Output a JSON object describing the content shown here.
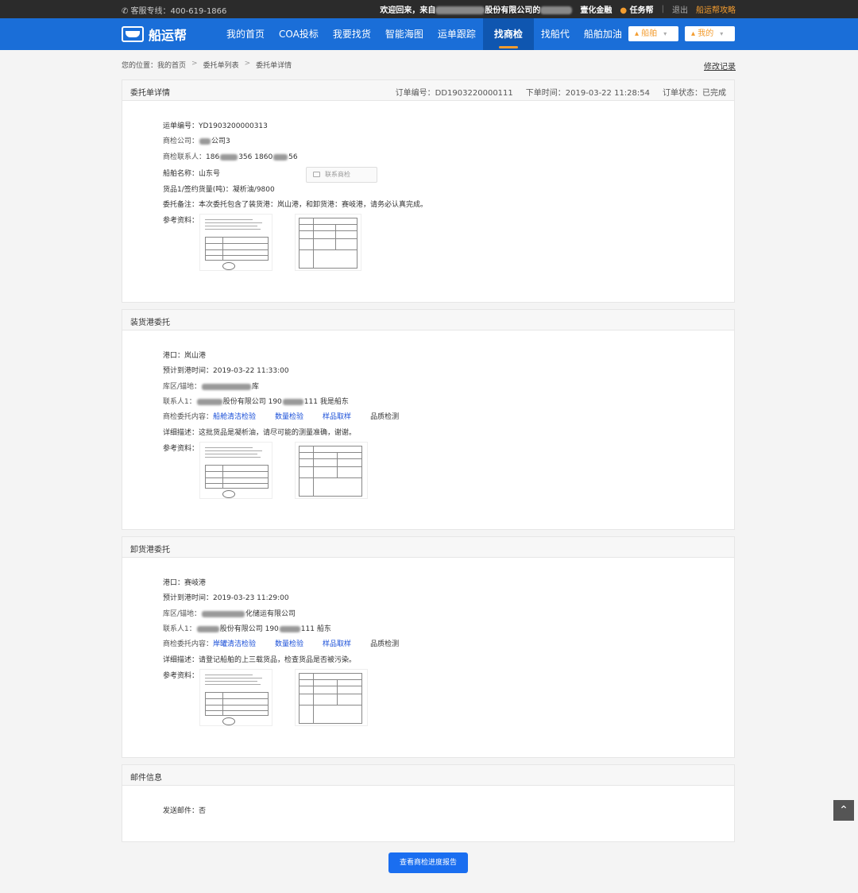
{
  "topbar": {
    "hotline": "✆ 客服专线：400-619-1866",
    "welcome": "欢迎回来，来自",
    "company_suffix": "股份有限公司的",
    "finance": "壹化金融",
    "task": "任务帮",
    "logout": "退出",
    "guide": "船运帮攻略"
  },
  "nav": {
    "logo": "船运帮",
    "items": [
      "我的首页",
      "COA投标",
      "我要找货",
      "智能海图",
      "运单跟踪",
      "找商检",
      "找船代",
      "船舶加油"
    ],
    "ship_btn": "船舶",
    "mine_btn": "我的"
  },
  "breadcrumb": {
    "location": "您的位置：我的首页",
    "list": "委托单列表",
    "current": "委托单详情",
    "modify_log": "修改记录"
  },
  "order": {
    "title": "委托单详情",
    "order_no_label": "订单编号：",
    "order_no": "DD1903220000111",
    "time_label": "下单时间：",
    "time": "2019-03-22 11:28:54",
    "status_label": "订单状态：",
    "status": "已完成",
    "waybill": "运单编号：YD1903200000313",
    "inspect_company_label": "商检公司：",
    "inspect_company_suffix": "公司3",
    "contact_label": "商检联系人：",
    "contact_a_pre": "186",
    "contact_a_post": "356",
    "contact_b_pre": "1860",
    "contact_b_post": "56",
    "contact_btn": "联系商检",
    "ship": "船舶名称：山东号",
    "cargo": "货品1/签约货量(吨)：凝析油/9800",
    "remark": "委托备注：本次委托包含了装货港：岚山港，和卸货港：赛岐港，请务必认真完成。",
    "ref": "参考资料："
  },
  "loading": {
    "title": "装货港委托",
    "port": "港口：岚山港",
    "eta": "预计到港时间：2019-03-22 11:33:00",
    "area_label": "库区/锚地：",
    "area_suffix": "库",
    "contact_label": "联系人1：",
    "contact_mid": "股份有限公司 190",
    "contact_end": "111 我是船东",
    "content_label": "商检委托内容：",
    "items": [
      "船舱清洁检验",
      "数量检验",
      "样品取样"
    ],
    "quality": "品质检测",
    "desc": "详细描述：这批货品是凝析油，请尽可能的测量准确，谢谢。",
    "ref": "参考资料："
  },
  "unloading": {
    "title": "卸货港委托",
    "port": "港口：赛岐港",
    "eta": "预计到港时间：2019-03-23 11:29:00",
    "area_label": "库区/锚地：",
    "area_suffix": "化储运有限公司",
    "contact_label": "联系人1：",
    "contact_mid": "股份有限公司 190",
    "contact_end": "111 船东",
    "content_label": "商检委托内容：",
    "items": [
      "岸罐清洁检验",
      "数量检验",
      "样品取样"
    ],
    "quality": "品质检测",
    "desc": "详细描述：请登记船舶的上三载货品，检查货品是否被污染。",
    "ref": "参考资料："
  },
  "mail": {
    "title": "邮件信息",
    "send": "发送邮件：否"
  },
  "report_btn": "查看商检进度报告",
  "colors": {
    "nav_blue": "#1a6ed8",
    "accent_orange": "#f39c2f",
    "link_blue": "#1a4fd8"
  }
}
